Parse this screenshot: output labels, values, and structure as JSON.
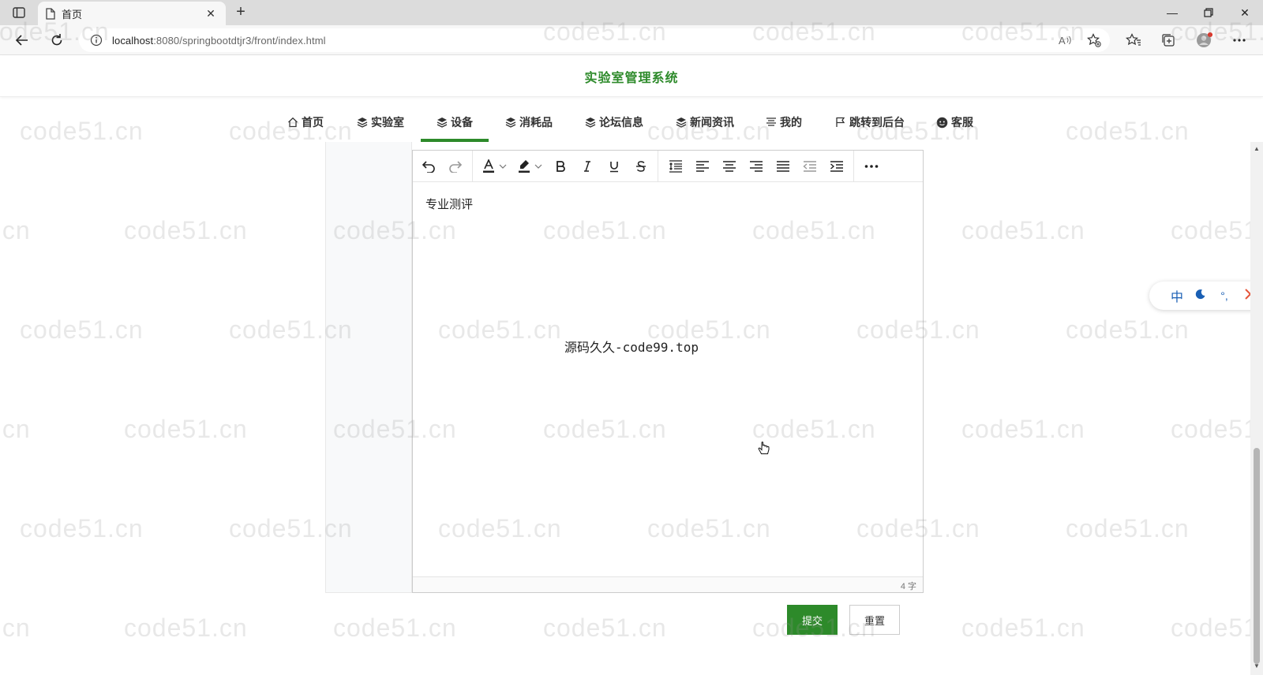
{
  "browser": {
    "tab_title": "首页",
    "url_host": "localhost",
    "url_rest": ":8080/springbootdtjr3/front/index.html"
  },
  "site": {
    "title": "实验室管理系统"
  },
  "nav": {
    "items": [
      {
        "label": "首页",
        "icon": "home-icon"
      },
      {
        "label": "实验室",
        "icon": "layers-icon"
      },
      {
        "label": "设备",
        "icon": "layers-icon",
        "active": true
      },
      {
        "label": "消耗品",
        "icon": "layers-icon"
      },
      {
        "label": "论坛信息",
        "icon": "layers-icon"
      },
      {
        "label": "新闻资讯",
        "icon": "layers-icon"
      },
      {
        "label": "我的",
        "icon": "list-icon"
      },
      {
        "label": "跳转到后台",
        "icon": "flag-icon"
      },
      {
        "label": "客服",
        "icon": "chat-icon"
      }
    ],
    "active_color": "#2d8a2a"
  },
  "editor": {
    "content": "专业测评",
    "word_count": "4 字",
    "toolbar": [
      "undo-icon",
      "redo-icon",
      "font-color-icon",
      "highlight-icon",
      "bold-icon",
      "italic-icon",
      "underline-icon",
      "strikethrough-icon",
      "line-height-icon",
      "align-left-icon",
      "align-center-icon",
      "align-right-icon",
      "justify-icon",
      "outdent-icon",
      "indent-icon",
      "more-icon"
    ]
  },
  "overlay_text": "源码久久-code99.top",
  "watermark": "code51.cn",
  "ime": {
    "lang": "中",
    "mode_icon": "moon-icon",
    "punct": "°,",
    "expand_icon": "chevron-right-icon"
  },
  "actions": {
    "submit": "提交",
    "reset": "重置"
  },
  "colors": {
    "brand": "#2d8a2a"
  }
}
